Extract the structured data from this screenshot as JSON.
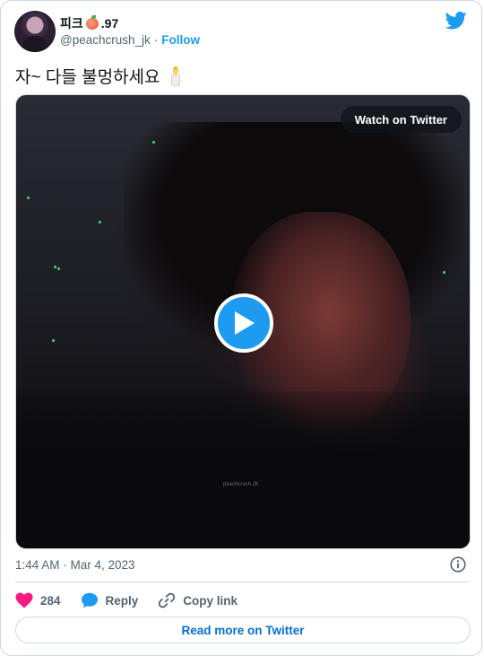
{
  "author": {
    "display_name_prefix": "피크",
    "display_name_suffix": ".97",
    "name_emoji_icon": "peach-icon",
    "handle": "@peachcrush_jk",
    "separator": "·",
    "follow_label": "Follow"
  },
  "tweet": {
    "text": "자~ 다들 불멍하세요",
    "emoji_icon": "candle-icon",
    "timestamp": "1:44 AM · Mar 4, 2023"
  },
  "media": {
    "watch_label": "Watch on Twitter",
    "watermark": "peachcrush.JK",
    "play_icon": "play-icon"
  },
  "actions": {
    "like_count": "284",
    "reply_label": "Reply",
    "copy_label": "Copy link"
  },
  "footer": {
    "read_more_label": "Read more on Twitter"
  },
  "colors": {
    "accent": "#1d9bf0",
    "like": "#f91880",
    "text_secondary": "#536471",
    "border": "#cfd9de",
    "link_dark": "#006fd6"
  }
}
